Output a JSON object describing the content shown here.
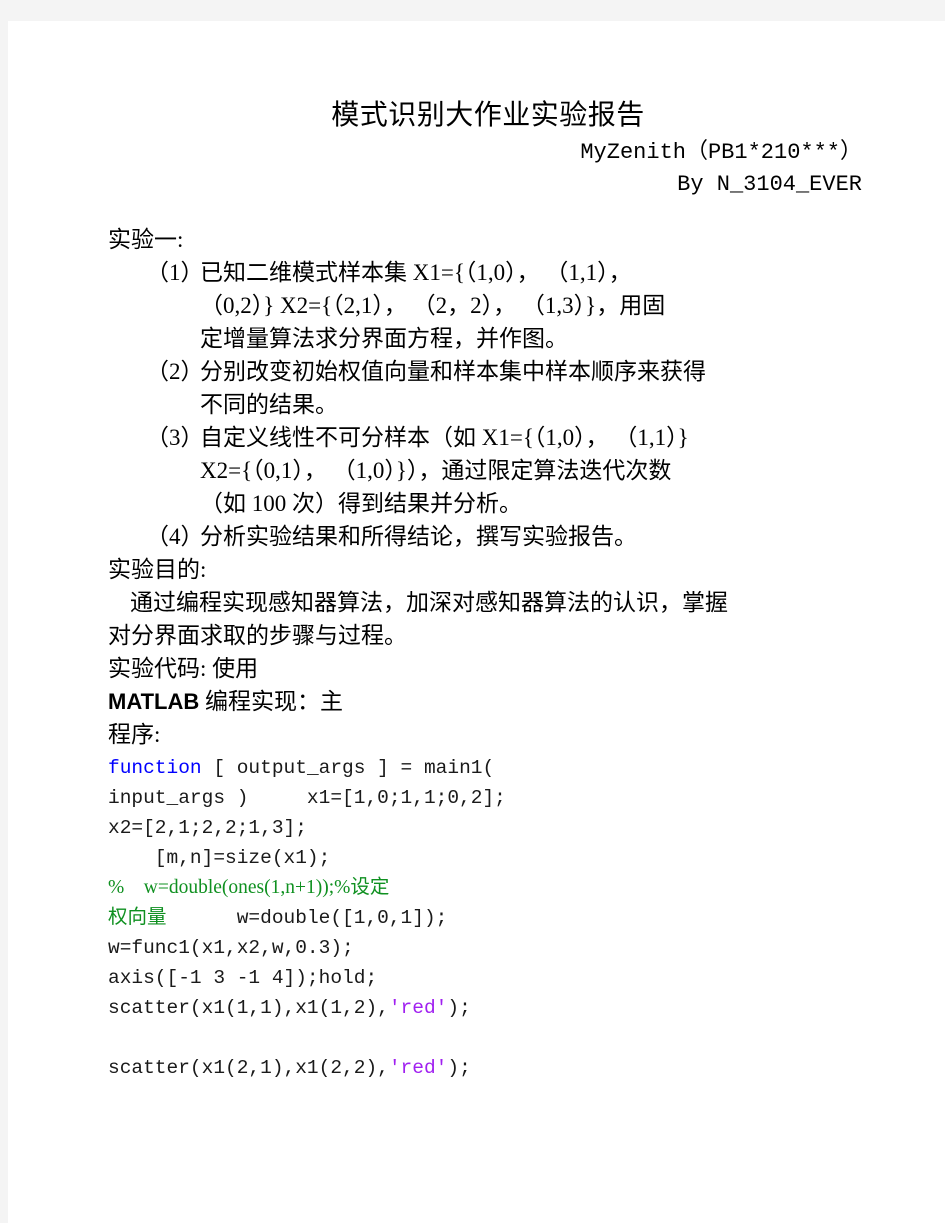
{
  "document": {
    "title": "模式识别大作业实验报告",
    "byline_author": "MyZenith（PB1*210***）",
    "byline_by": "By N_3104_EVER"
  },
  "experiment": {
    "heading": "实验一:",
    "tasks": [
      {
        "marker": "（1）",
        "lines": [
          "已知二维模式样本集 X1={（1,0）， （1,1），",
          "（0,2）} X2={（2,1）， （2，2）， （1,3）}，用固",
          "定增量算法求分界面方程，并作图。"
        ]
      },
      {
        "marker": "（2）",
        "lines": [
          "分别改变初始权值向量和样本集中样本顺序来获得",
          "不同的结果。"
        ]
      },
      {
        "marker": "（3）",
        "lines": [
          "自定义线性不可分样本（如 X1={（1,0）， （1,1）}",
          "X2={（0,1）， （1,0）}），通过限定算法迭代次数",
          "（如 100 次）得到结果并分析。"
        ]
      },
      {
        "marker": "（4）",
        "lines": [
          "分析实验结果和所得结论，撰写实验报告。"
        ]
      }
    ]
  },
  "purpose": {
    "heading": "实验目的:",
    "line1": "通过编程实现感知器算法，加深对感知器算法的认识，掌握",
    "line2": "对分界面求取的步骤与过程。"
  },
  "code_section": {
    "heading_line1": "实验代码: 使用",
    "heading_line2_latin": "MATLAB",
    "heading_line2_rest": " 编程实现：主",
    "heading_line3": "程序:"
  },
  "code": {
    "lines": [
      {
        "segments": [
          {
            "text": "function",
            "token": "keyword"
          },
          {
            "text": " [ output_args ] = main1(",
            "token": "plain"
          }
        ]
      },
      {
        "segments": [
          {
            "text": "input_args )     x1=[1,0;1,1;0,2];",
            "token": "plain"
          }
        ]
      },
      {
        "segments": [
          {
            "text": "x2=[2,1;2,2;1,3];",
            "token": "plain"
          }
        ]
      },
      {
        "segments": [
          {
            "text": "    [m,n]=size(x1);",
            "token": "plain"
          }
        ]
      },
      {
        "segments": [
          {
            "text": "%    w=double(ones(1,n+1));%设定",
            "token": "comment"
          }
        ]
      },
      {
        "segments": [
          {
            "text": "权向量",
            "token": "comment"
          },
          {
            "text": "      w=double([1,0,1]);",
            "token": "plain"
          }
        ]
      },
      {
        "segments": [
          {
            "text": "w=func1(x1,x2,w,0.3);",
            "token": "plain"
          }
        ]
      },
      {
        "segments": [
          {
            "text": "axis([-1 3 -1 4]);hold;",
            "token": "plain"
          }
        ]
      },
      {
        "segments": [
          {
            "text": "scatter(x1(1,1),x1(1,2),",
            "token": "plain"
          },
          {
            "text": "'red'",
            "token": "string"
          },
          {
            "text": ");",
            "token": "plain"
          }
        ]
      },
      {
        "segments": []
      },
      {
        "segments": [
          {
            "text": "scatter(x1(2,1),x1(2,2),",
            "token": "plain"
          },
          {
            "text": "'red'",
            "token": "string"
          },
          {
            "text": ");",
            "token": "plain"
          }
        ]
      }
    ]
  },
  "colors": {
    "page_background": "#f4f4f4",
    "sheet": "#ffffff",
    "text": "#000000",
    "code_text": "#1a1a1a",
    "keyword": "#0000ff",
    "comment": "#0f9020",
    "string": "#a020f0"
  }
}
